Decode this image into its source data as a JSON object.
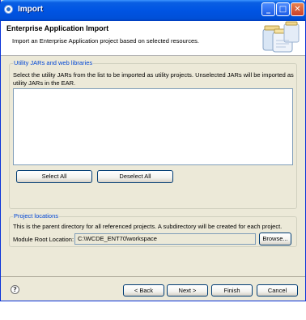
{
  "window": {
    "title": "Import",
    "minimize_glyph": "_",
    "maximize_glyph": "□",
    "close_glyph": "✕"
  },
  "banner": {
    "title": "Enterprise Application Import",
    "description": "Import an Enterprise Application project based on selected resources.",
    "icon": "jar-stack-icon"
  },
  "utility_jars": {
    "legend": "Utility JARs and web libraries",
    "instructions": "Select the utility JARs from the list to be imported as utility projects. Unselected JARs will be imported as utility JARs in the EAR.",
    "items": [],
    "select_all_label": "Select All",
    "deselect_all_label": "Deselect All"
  },
  "project_locations": {
    "legend": "Project locations",
    "description": "This is the parent directory for all referenced projects. A subdirectory will be created for each project.",
    "module_root_label": "Module Root Location:",
    "module_root_value": "C:\\WCDE_ENT70\\workspace",
    "browse_label": "Browse..."
  },
  "footer": {
    "help_glyph": "?",
    "back_label": "< Back",
    "next_label": "Next >",
    "finish_label": "Finish",
    "cancel_label": "Cancel"
  },
  "colors": {
    "titlebar": "#0054e3",
    "dialog_bg": "#ece9d8",
    "legend_text": "#0046d5",
    "button_border": "#003c74"
  }
}
